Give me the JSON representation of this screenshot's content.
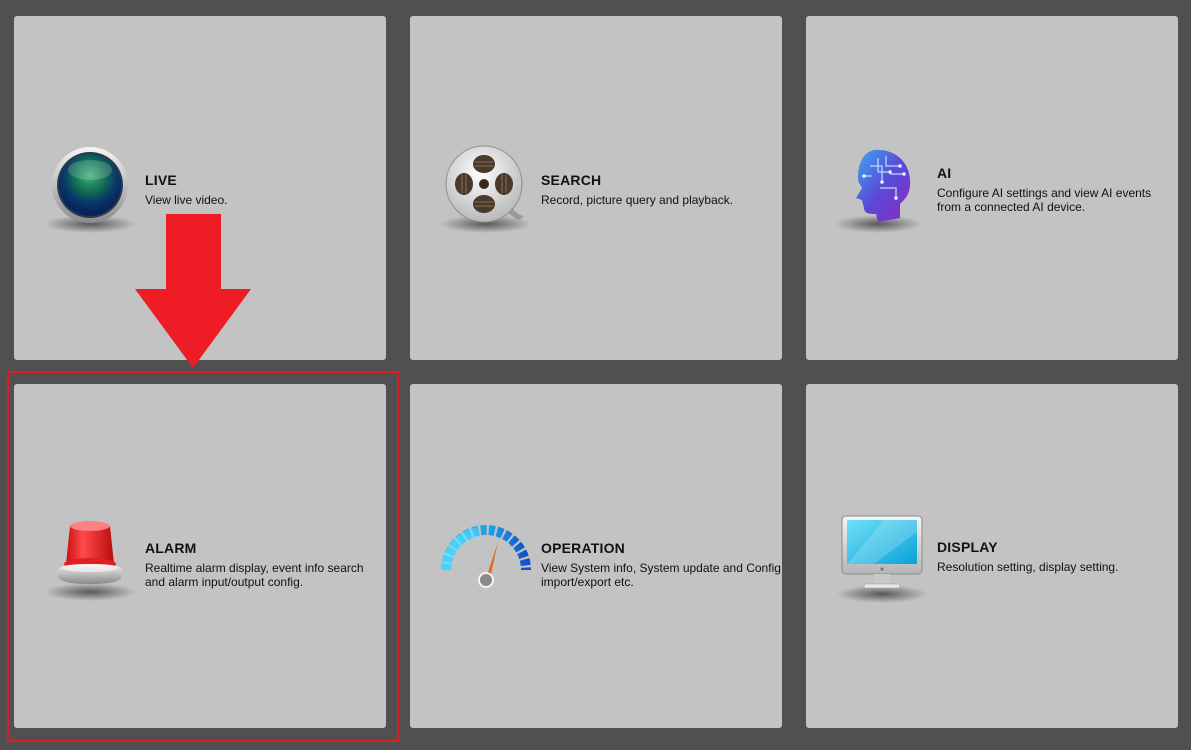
{
  "tiles": [
    {
      "title": "LIVE",
      "desc": "View live video.",
      "icon": "live-lens-icon"
    },
    {
      "title": "SEARCH",
      "desc": "Record, picture query and playback.",
      "icon": "film-reel-icon"
    },
    {
      "title": "AI",
      "desc": "Configure AI settings and view AI events from a connected AI device.",
      "icon": "ai-head-icon"
    },
    {
      "title": "ALARM",
      "desc": "Realtime alarm display, event info search and alarm input/output config.",
      "icon": "alarm-siren-icon"
    },
    {
      "title": "OPERATION",
      "desc": "View System info, System update and Config import/export etc.",
      "icon": "gauge-icon"
    },
    {
      "title": "DISPLAY",
      "desc": "Resolution setting, display setting.",
      "icon": "monitor-icon"
    }
  ],
  "annotation": {
    "arrow_color": "#ee1c25",
    "highlight_color": "#e01b24",
    "highlighted_tile": "ALARM"
  }
}
